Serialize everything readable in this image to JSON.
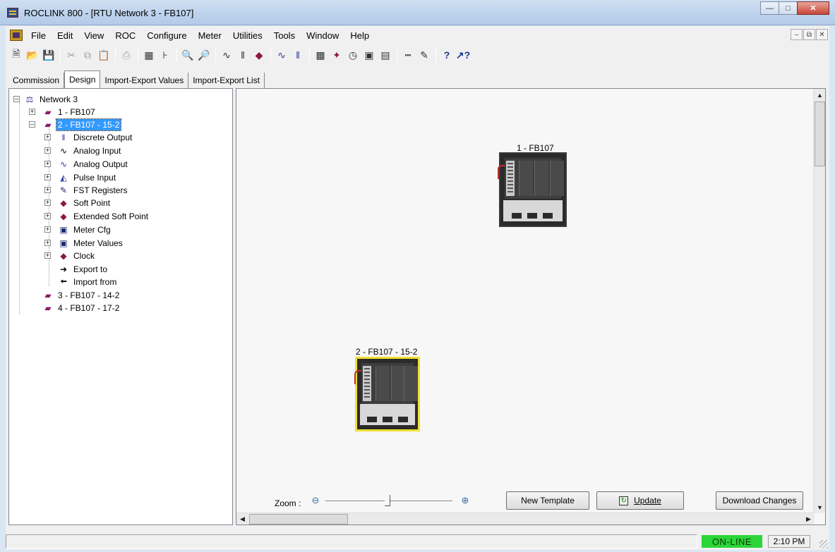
{
  "window": {
    "title": "ROCLINK 800 - [RTU Network 3 - FB107]"
  },
  "menu": [
    "File",
    "Edit",
    "View",
    "ROC",
    "Configure",
    "Meter",
    "Utilities",
    "Tools",
    "Window",
    "Help"
  ],
  "tabs": [
    "Commission",
    "Design",
    "Import-Export Values",
    "Import-Export List"
  ],
  "tree": {
    "root": "Network 3",
    "devices": [
      "1 - FB107",
      "2 - FB107 - 15-2",
      "3 - FB107 - 14-2",
      "4 - FB107 - 17-2"
    ],
    "children": [
      "Discrete Output",
      "Analog Input",
      "Analog Output",
      "Pulse Input",
      "FST Registers",
      "Soft Point",
      "Extended Soft Point",
      "Meter Cfg",
      "Meter Values",
      "Clock",
      "Export to",
      "Import from"
    ]
  },
  "canvas": {
    "device1_label": "1 - FB107",
    "device2_label": "2 - FB107 - 15-2",
    "zoom_label": "Zoom :",
    "new_template": "New Template",
    "update": "Update",
    "download": "Download Changes"
  },
  "status": {
    "online": "ON-LINE",
    "time": "2:10 PM"
  }
}
